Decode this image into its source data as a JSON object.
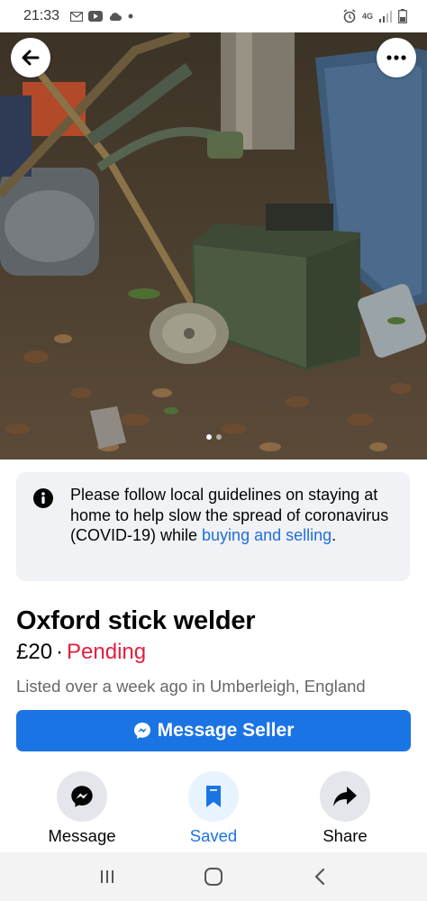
{
  "status_bar": {
    "time": "21:33",
    "network": "4G"
  },
  "photo": {
    "alt_subject": "Oxford stick welder photo",
    "dots_count": 2,
    "active_dot": 1
  },
  "notice": {
    "text": "Please follow local guidelines on staying at home to help slow the spread of coronavirus (COVID-19) while ",
    "link": "buying and selling",
    "end": "."
  },
  "listing": {
    "title": "Oxford stick welder",
    "price": "£20",
    "separator": "·",
    "status": "Pending",
    "meta": "Listed over a week ago in Umberleigh, England"
  },
  "primary_button": {
    "label": "Message Seller"
  },
  "actions": [
    {
      "label": "Message",
      "icon": "messenger-icon"
    },
    {
      "label": "Saved",
      "icon": "bookmark-icon"
    },
    {
      "label": "Share",
      "icon": "share-icon"
    }
  ],
  "colors": {
    "accent": "#1b74e4",
    "pending": "#e41e3f",
    "link": "#216fdb",
    "muted": "#65676b"
  }
}
